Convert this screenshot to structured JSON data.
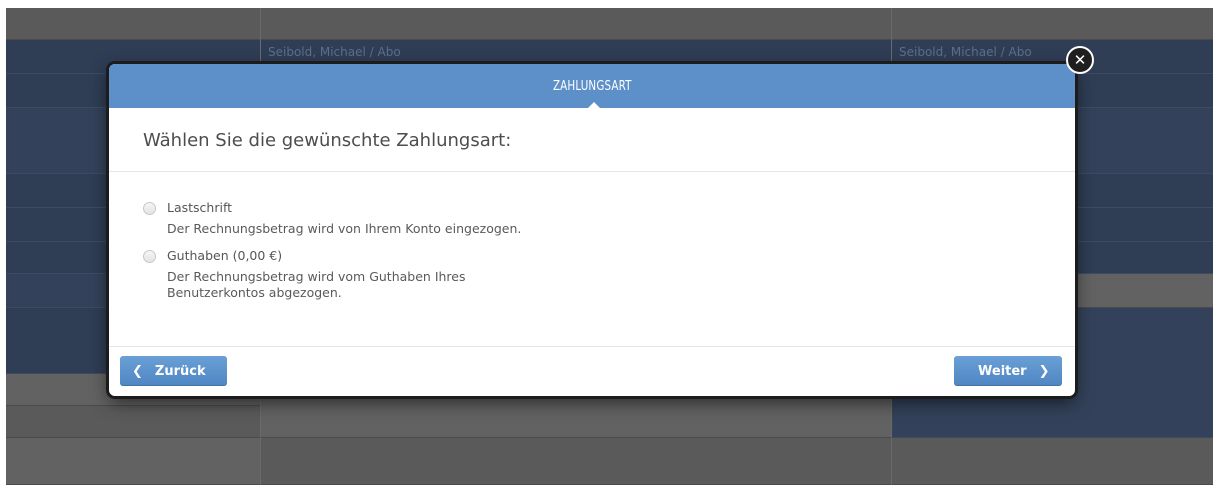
{
  "background": {
    "cell_left": "Seibold, Michael / Abo",
    "cell_right": "Seibold, Michael / Abo"
  },
  "modal": {
    "title": "ZAHLUNGSART",
    "heading": "Wählen Sie die gewünschte Zahlungsart:",
    "options": [
      {
        "label": "Lastschrift",
        "description": "Der Rechnungsbetrag wird von Ihrem Konto eingezogen.",
        "selected": false
      },
      {
        "label": "Guthaben (0,00 €)",
        "description": "Der Rechnungsbetrag wird vom Guthaben Ihres Benutzerkontos abgezogen.",
        "selected": false
      }
    ],
    "back_label": "Zurück",
    "next_label": "Weiter",
    "icons": {
      "back": "chevron-left-icon",
      "next": "chevron-right-icon",
      "close": "close-icon"
    }
  },
  "colors": {
    "header": "#5d90c9",
    "button": "#5a90cc",
    "overlay_blue": "#2f3d55"
  }
}
